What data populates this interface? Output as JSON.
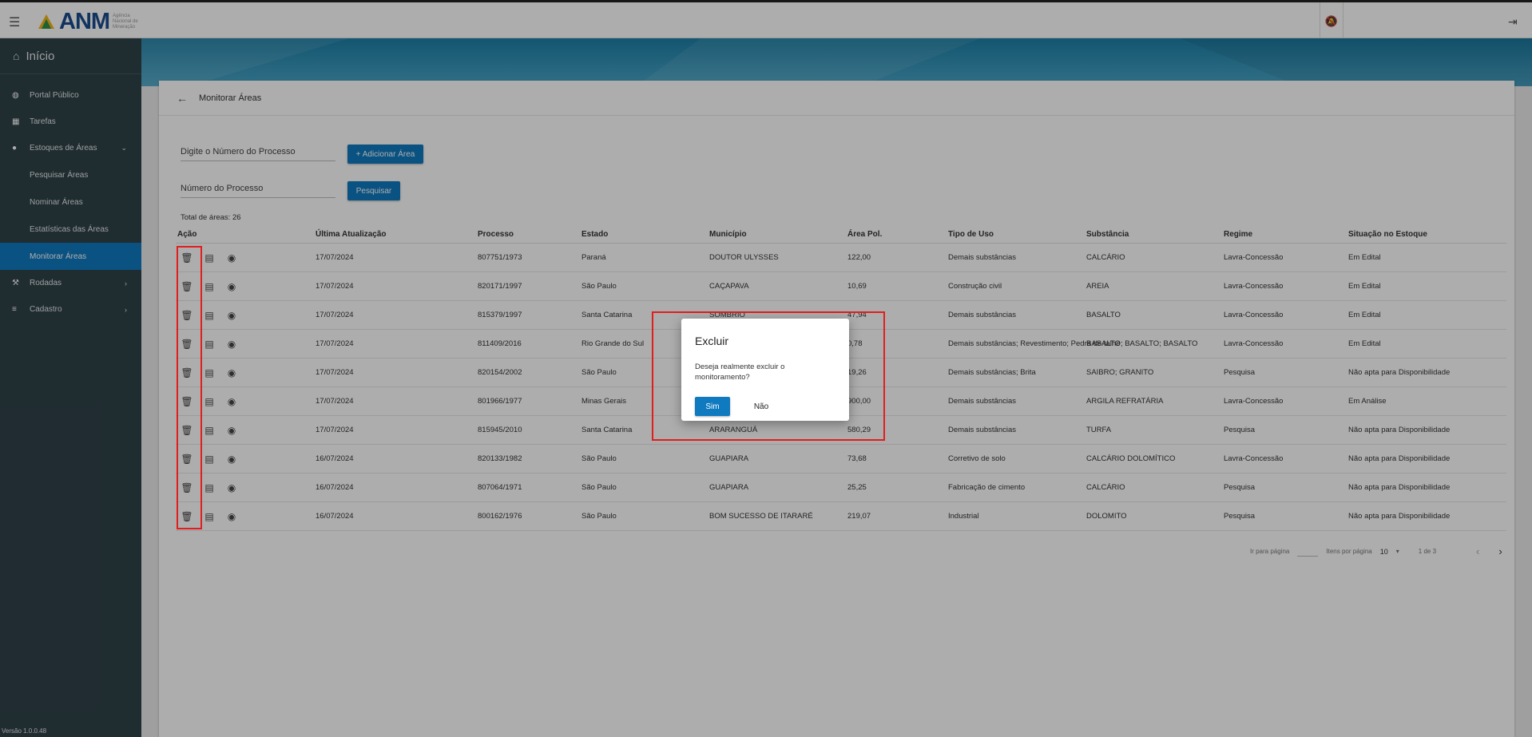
{
  "header": {
    "logo_text": "ANM",
    "logo_subtitle": "Agência Nacional de Mineração",
    "menu_icon": "hamburger-icon",
    "notifications_icon": "bell-off-icon",
    "logout_icon": "logout-icon"
  },
  "sidebar": {
    "home_label": "Início",
    "items": [
      {
        "label": "Portal Público",
        "icon": "globe-icon"
      },
      {
        "label": "Tarefas",
        "icon": "dashboard-icon"
      },
      {
        "label": "Estoques de Áreas",
        "icon": "location-pin-icon",
        "expanded": true
      },
      {
        "label": "Rodadas",
        "icon": "gavel-icon"
      },
      {
        "label": "Cadastro",
        "icon": "list-icon"
      }
    ],
    "subitems": [
      "Pesquisar Áreas",
      "Nominar Áreas",
      "Estatísticas das Áreas",
      "Monitorar Áreas"
    ],
    "active_subitem": "Monitorar Áreas",
    "version": "Versão 1.0.0.48"
  },
  "page": {
    "title": "Monitorar Áreas",
    "add_field_placeholder": "Digite o Número do Processo",
    "add_button": "+ Adicionar Área",
    "search_field_placeholder": "Número do Processo",
    "search_button": "Pesquisar",
    "total_label": "Total de áreas: 26"
  },
  "table": {
    "columns": [
      "Ação",
      "Última Atualização",
      "Processo",
      "Estado",
      "Município",
      "Área Pol.",
      "Tipo de Uso",
      "Substância",
      "Regime",
      "Situação no Estoque"
    ],
    "rows": [
      [
        "17/07/2024",
        "807751/1973",
        "Paraná",
        "DOUTOR ULYSSES",
        "122,00",
        "Demais substâncias",
        "CALCÁRIO",
        "Lavra-Concessão",
        "Em Edital"
      ],
      [
        "17/07/2024",
        "820171/1997",
        "São Paulo",
        "CAÇAPAVA",
        "10,69",
        "Construção civil",
        "AREIA",
        "Lavra-Concessão",
        "Em Edital"
      ],
      [
        "17/07/2024",
        "815379/1997",
        "Santa Catarina",
        "SOMBRIO",
        "47,94",
        "Demais substâncias",
        "BASALTO",
        "Lavra-Concessão",
        "Em Edital"
      ],
      [
        "17/07/2024",
        "811409/2016",
        "Rio Grande do Sul",
        "",
        "0,78",
        "Demais substâncias; Revestimento; Pedra de talhe",
        "BASALTO; BASALTO; BASALTO",
        "Lavra-Concessão",
        "Em Edital"
      ],
      [
        "17/07/2024",
        "820154/2002",
        "São Paulo",
        "",
        "19,26",
        "Demais substâncias; Brita",
        "SAIBRO; GRANITO",
        "Pesquisa",
        "Não apta para Disponibilidade"
      ],
      [
        "17/07/2024",
        "801966/1977",
        "Minas Gerais",
        "",
        "900,00",
        "Demais substâncias",
        "ARGILA REFRATÁRIA",
        "Lavra-Concessão",
        "Em Análise"
      ],
      [
        "17/07/2024",
        "815945/2010",
        "Santa Catarina",
        "ARARANGUÁ",
        "580,29",
        "Demais substâncias",
        "TURFA",
        "Pesquisa",
        "Não apta para Disponibilidade"
      ],
      [
        "16/07/2024",
        "820133/1982",
        "São Paulo",
        "GUAPIARA",
        "73,68",
        "Corretivo de solo",
        "CALCÁRIO DOLOMÍTICO",
        "Lavra-Concessão",
        "Não apta para Disponibilidade"
      ],
      [
        "16/07/2024",
        "807064/1971",
        "São Paulo",
        "GUAPIARA",
        "25,25",
        "Fabricação de cimento",
        "CALCÁRIO",
        "Pesquisa",
        "Não apta para Disponibilidade"
      ],
      [
        "16/07/2024",
        "800162/1976",
        "São Paulo",
        "BOM SUCESSO DE ITARARÉ",
        "219,07",
        "Industrial",
        "DOLOMITO",
        "Pesquisa",
        "Não apta para Disponibilidade"
      ]
    ]
  },
  "pagination": {
    "goto_label": "Ir para página",
    "per_page_label": "Itens por página",
    "per_page_value": "10",
    "range": "1 de 3"
  },
  "dialog": {
    "title": "Excluir",
    "message": "Deseja realmente excluir o monitoramento?",
    "yes": "Sim",
    "no": "Não"
  }
}
